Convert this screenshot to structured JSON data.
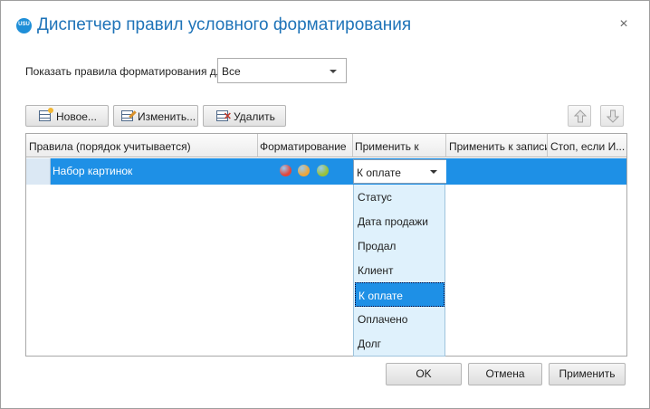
{
  "dialog": {
    "title": "Диспетчер правил условного форматирования",
    "logo_text": "USU",
    "close_glyph": "×"
  },
  "filter": {
    "label": "Показать правила форматирования для:",
    "value": "Все"
  },
  "toolbar": {
    "new_label": "Новое...",
    "edit_label": "Изменить...",
    "delete_label": "Удалить"
  },
  "grid": {
    "columns": [
      "Правила (порядок учитывается)",
      "Форматирование",
      "Применить к",
      "Применить к записи",
      "Стоп, если И..."
    ],
    "rows": [
      {
        "name": "Набор картинок",
        "format_colors": [
          "#e2463b",
          "#eea63a",
          "#9ac13a"
        ],
        "apply_to": "К оплате"
      }
    ]
  },
  "apply_dropdown": {
    "options": [
      "Статус",
      "Дата продажи",
      "Продал",
      "Клиент",
      "К оплате",
      "Оплачено",
      "Долг"
    ],
    "selected": "К оплате"
  },
  "footer": {
    "ok_label": "OK",
    "cancel_label": "Отмена",
    "apply_label": "Применить"
  },
  "colors": {
    "title": "#1e73b8",
    "selection": "#1e90e6",
    "dropdown_bg": "#dff1fc"
  }
}
